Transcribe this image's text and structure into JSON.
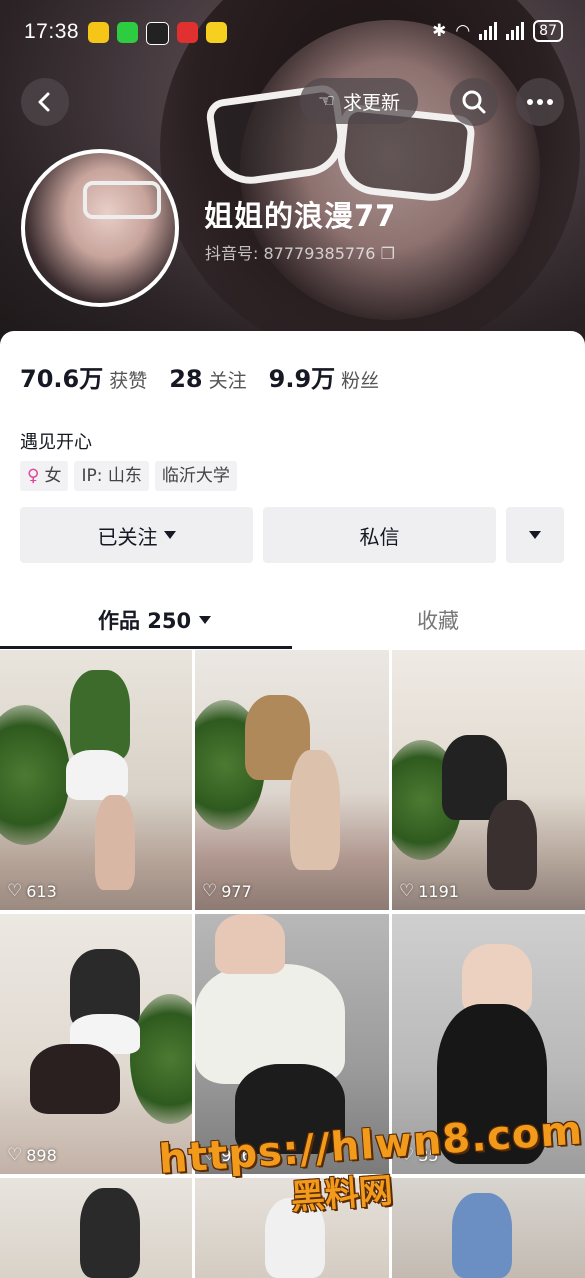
{
  "status_bar": {
    "time": "17:38",
    "battery": "87",
    "app_icon_colors": [
      "#f5c518",
      "#2ecc40",
      "#222222",
      "#e03030",
      "#f5d020"
    ]
  },
  "header": {
    "request_update_label": "求更新",
    "back_icon": "chevron-left-icon",
    "search_icon": "search-icon",
    "more_icon": "more-icon",
    "nickname": "姐姐的浪漫77",
    "douyin_id": "抖音号: 87779385776"
  },
  "stats": {
    "likes_num": "70.6万",
    "likes_label": "获赞",
    "following_num": "28",
    "following_label": "关注",
    "followers_num": "9.9万",
    "followers_label": "粉丝"
  },
  "bio": "遇见开心",
  "tags": {
    "gender": "女",
    "ip": "IP: 山东",
    "school": "临沂大学"
  },
  "actions": {
    "followed_label": "已关注",
    "message_label": "私信"
  },
  "tabs": {
    "works_label": "作品 250",
    "favorites_label": "收藏"
  },
  "videos": [
    {
      "likes": "613"
    },
    {
      "likes": "977"
    },
    {
      "likes": "1191"
    },
    {
      "likes": "898"
    },
    {
      "likes": "926"
    },
    {
      "likes": "35"
    }
  ],
  "watermark": {
    "url": "https://hlwn8.com",
    "text": "黑料网"
  },
  "colors": {
    "accent_pink": "#e0439b",
    "watermark_orange": "#f29a1c"
  }
}
